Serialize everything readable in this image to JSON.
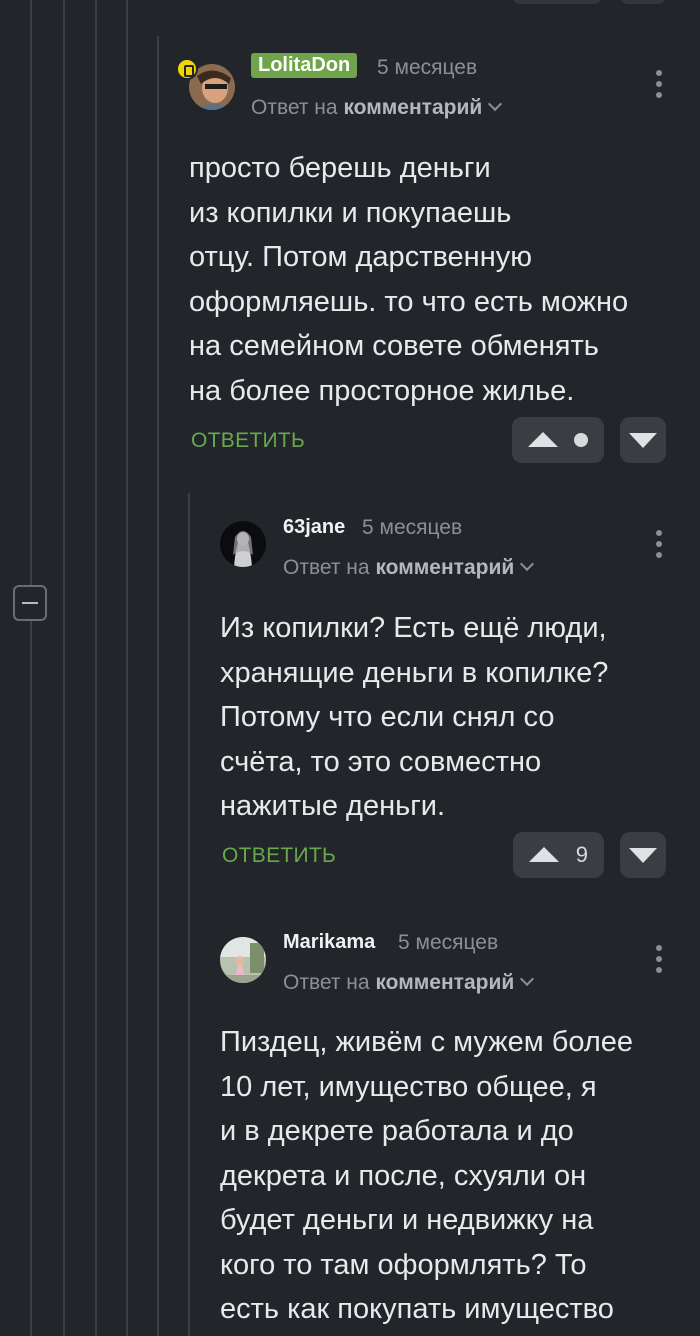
{
  "comments": [
    {
      "username": "LolitaDon",
      "time": "5 месяцев",
      "reply_prefix": "Ответ на",
      "reply_target": "комментарий",
      "text": "просто берешь деньги\nиз копилки и покупаешь\nотцу. Потом дарственную\nоформляешь. то что есть можно\nна семейном совете обменять\nна более просторное жилье.",
      "reply_label": "ОТВЕТИТЬ",
      "rating": "•"
    },
    {
      "username": "63jane",
      "time": "5 месяцев",
      "reply_prefix": "Ответ на",
      "reply_target": "комментарий",
      "text": "Из копилки? Есть ещё люди,\nхранящие деньги в копилке?\nПотому что если снял со\nсчёта, то это совместно\nнажитые деньги.",
      "reply_label": "ОТВЕТИТЬ",
      "rating": "9"
    },
    {
      "username": "Marikama",
      "time": "5 месяцев",
      "reply_prefix": "Ответ на",
      "reply_target": "комментарий",
      "text": "Пиздец, живём с мужем более\n10 лет, имущество общее, я\nи в декрете работала и до\nдекрета и после, схуяли он\nбудет деньги и недвижку на\nкого то там оформлять? То\nесть как покупать имущество"
    }
  ],
  "colors": {
    "background": "#222529",
    "accent_green": "#6aa84f",
    "username_badge": "#6fa54a",
    "thread_line": "#3c4046"
  },
  "icons": [
    "collapse-thread-icon",
    "more-options-icon",
    "chevron-down-icon",
    "upvote-icon",
    "downvote-icon"
  ]
}
